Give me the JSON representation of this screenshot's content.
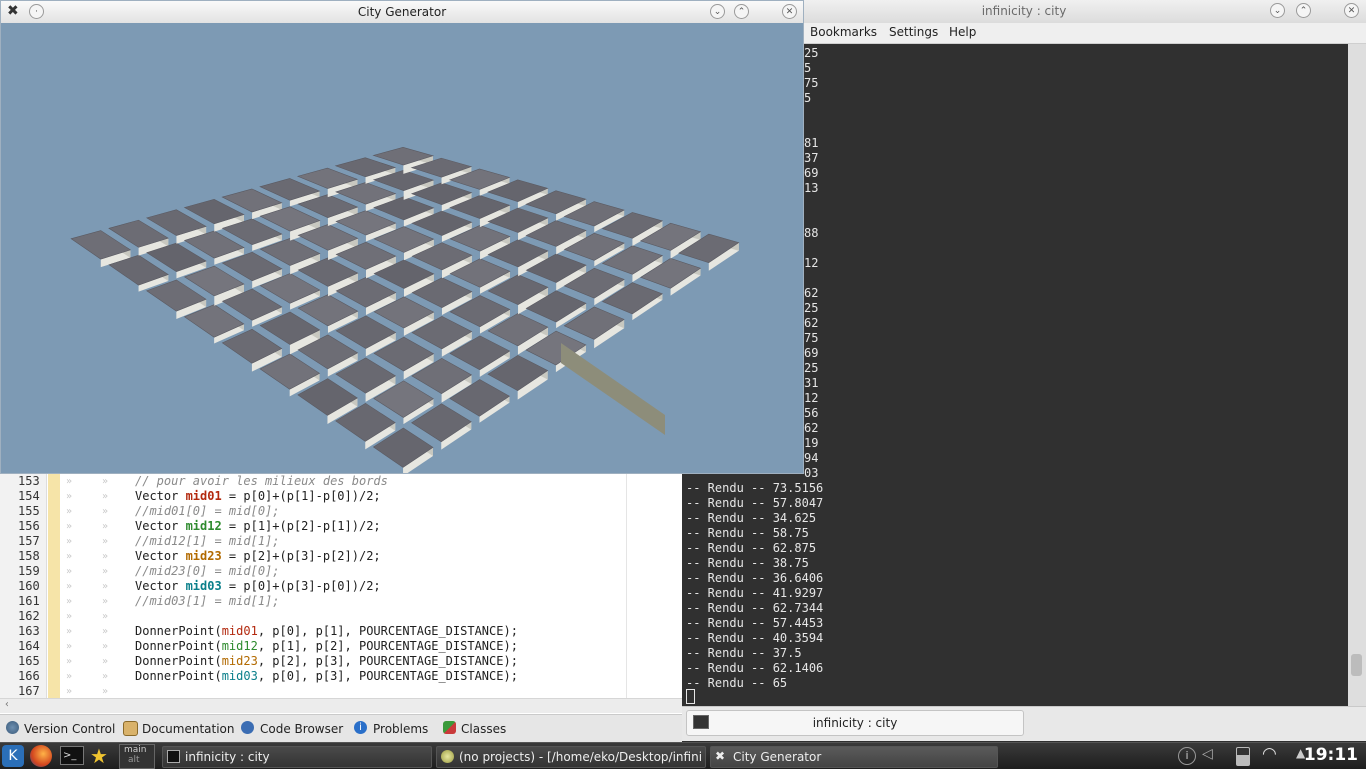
{
  "terminal": {
    "title": "infinicity : city",
    "menus": [
      "Bookmarks",
      "Settings",
      "Help"
    ],
    "tab_label": "infinicity : city",
    "hidden_fragments": [
      "25",
      "5",
      "75",
      "5",
      "",
      "",
      "81",
      "37",
      "69",
      "13",
      "",
      "",
      "88",
      "",
      "12",
      "",
      "62",
      "25",
      "62",
      "75",
      "69",
      "25",
      "31",
      "12",
      "56",
      "62",
      "19",
      "94",
      "03"
    ],
    "lines": [
      "-- Rendu -- 73.5156",
      "-- Rendu -- 57.8047",
      "-- Rendu -- 34.625",
      "-- Rendu -- 58.75",
      "-- Rendu -- 62.875",
      "-- Rendu -- 38.75",
      "-- Rendu -- 36.6406",
      "-- Rendu -- 41.9297",
      "-- Rendu -- 62.7344",
      "-- Rendu -- 57.4453",
      "-- Rendu -- 40.3594",
      "-- Rendu -- 37.5",
      "-- Rendu -- 62.1406",
      "-- Rendu -- 65"
    ]
  },
  "editor": {
    "line_numbers": [
      "153",
      "154",
      "155",
      "156",
      "157",
      "158",
      "159",
      "160",
      "161",
      "162",
      "163",
      "164",
      "165",
      "166",
      "167"
    ],
    "code": {
      "l153": "// pour avoir les milieux des bords",
      "l154_kw": "Vector ",
      "l154_var": "mid01",
      "l154_rest": " = p[0]+(p[1]-p[0])/2;",
      "l155": "//mid01[0] = mid[0];",
      "l156_kw": "Vector ",
      "l156_var": "mid12",
      "l156_rest": " = p[1]+(p[2]-p[1])/2;",
      "l157": "//mid12[1] = mid[1];",
      "l158_kw": "Vector ",
      "l158_var": "mid23",
      "l158_rest": " = p[2]+(p[3]-p[2])/2;",
      "l159": "//mid23[0] = mid[0];",
      "l160_kw": "Vector ",
      "l160_var": "mid03",
      "l160_rest": " = p[0]+(p[3]-p[0])/2;",
      "l161": "//mid03[1] = mid[1];",
      "l163_fn": "DonnerPoint(",
      "l163_var": "mid01",
      "l163_rest": ", p[0], p[1], POURCENTAGE_DISTANCE);",
      "l164_fn": "DonnerPoint(",
      "l164_var": "mid12",
      "l164_rest": ", p[1], p[2], POURCENTAGE_DISTANCE);",
      "l165_fn": "DonnerPoint(",
      "l165_var": "mid23",
      "l165_rest": ", p[2], p[3], POURCENTAGE_DISTANCE);",
      "l166_fn": "DonnerPoint(",
      "l166_var": "mid03",
      "l166_rest": ", p[0], p[3], POURCENTAGE_DISTANCE);"
    }
  },
  "ide_toolbar": {
    "version_control": "Version Control",
    "documentation": "Documentation",
    "code_browser": "Code Browser",
    "problems": "Problems",
    "classes": "Classes"
  },
  "city_generator": {
    "title": "City Generator",
    "sky_color": "#7d9ab4",
    "block_color": "#6f6f78",
    "edge_color": "#e6e6e0"
  },
  "taskbar": {
    "pager_label_top": "main",
    "pager_label_bottom": "alt",
    "tasks": [
      "infinicity : city",
      "(no projects) - [/home/eko/Desktop/infinici",
      "City Generator"
    ],
    "clock": "19:11"
  }
}
